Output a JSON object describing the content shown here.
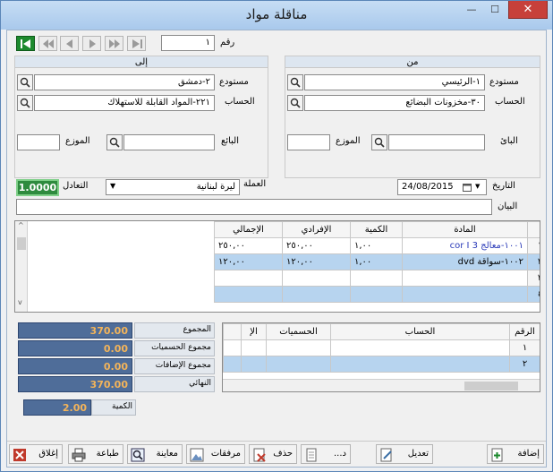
{
  "window": {
    "title": "مناقلة مواد",
    "close_glyph": "✕",
    "max_glyph": "☐",
    "min_glyph": "—"
  },
  "nav": {
    "number_label": "رقم",
    "number_value": "١"
  },
  "from": {
    "header": "من",
    "warehouse_label": "مستودع",
    "warehouse_value": "١-الرئيسي",
    "account_label": "الحساب",
    "account_value": "٣٠-مخزونات البضائع",
    "seller_label": "البائ",
    "distributor_label": "الموزع"
  },
  "to": {
    "header": "إلى",
    "warehouse_label": "مستودع",
    "warehouse_value": "٢-دمشق",
    "account_label": "الحساب",
    "account_value": "٢٢١-المواد القابلة للاستهلاك",
    "seller_label": "البائع",
    "distributor_label": "الموزع"
  },
  "meta": {
    "date_label": "التاريخ",
    "date_value": "24/08/2015",
    "currency_label": "العملة",
    "currency_value": "ليرة لبنانية",
    "rate_label": "التعادل",
    "rate_value": "1.0000",
    "notes_label": "البيان"
  },
  "items_grid": {
    "columns": [
      "المادة",
      "الكمية",
      "الإفرادي",
      "الإجمالي"
    ],
    "rows": [
      {
        "idx": "١",
        "material": "١٠٠١-معالج cor I 3",
        "qty": "١,٠٠",
        "unit": "٢٥٠,٠٠",
        "total": "٢٥٠,٠٠"
      },
      {
        "idx": "٢",
        "material": "١٠٠٢-سواقة dvd",
        "qty": "١,٠٠",
        "unit": "١٢٠,٠٠",
        "total": "١٢٠,٠٠"
      },
      {
        "idx": "٣",
        "material": "",
        "qty": "",
        "unit": "",
        "total": ""
      },
      {
        "idx": "٤",
        "material": "",
        "qty": "",
        "unit": "",
        "total": ""
      }
    ]
  },
  "totals": {
    "sum_label": "المجموع",
    "sum_value": "370.00",
    "discounts_label": "مجموع الحسميات",
    "discounts_value": "0.00",
    "additions_label": "مجموع الإضافات",
    "additions_value": "0.00",
    "final_label": "النهائي",
    "final_value": "370.00"
  },
  "accounts_grid": {
    "columns": [
      "الرقم",
      "الحساب",
      "الحسميات",
      "الإ"
    ],
    "rows": [
      {
        "idx": "١"
      },
      {
        "idx": "٢"
      }
    ]
  },
  "qty_box": {
    "label": "الكمية",
    "value": "2.00"
  },
  "toolbar": {
    "add": "إضافة",
    "edit": "تعديل",
    "new": "د...",
    "delete": "حذف",
    "attachments": "مرفقات",
    "preview": "معاينة",
    "print": "طباعة",
    "close": "إغلاق"
  },
  "colors": {
    "summary_bg": "#4f6d99",
    "summary_text": "#f3b45a",
    "rate_bg": "#2e8b3e",
    "selected_row": "#b7d4ef"
  },
  "icons": [
    "search-icon",
    "calendar-icon",
    "first-record-icon",
    "prev-record-icon",
    "next-record-icon",
    "last-record-icon",
    "print-icon",
    "preview-icon",
    "attachments-icon",
    "delete-icon",
    "close-icon"
  ]
}
